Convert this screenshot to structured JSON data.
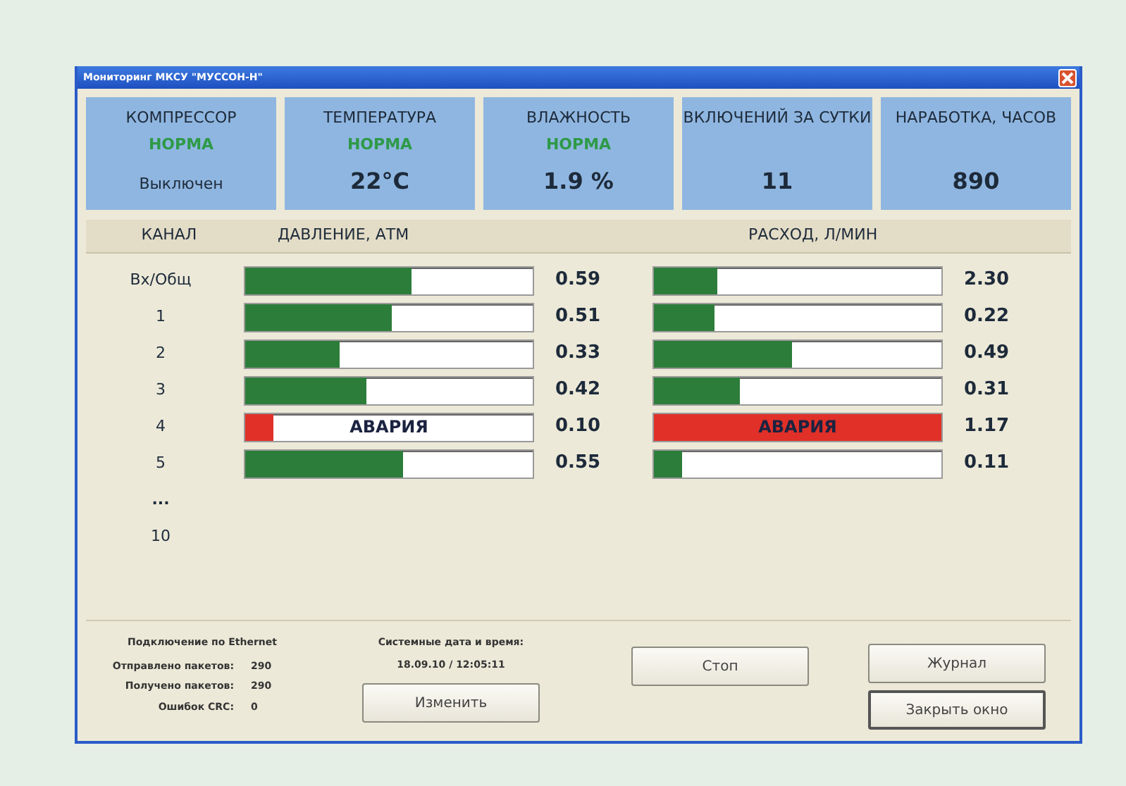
{
  "window": {
    "title": "Мониторинг МКСУ \"МУССОН-Н\""
  },
  "tiles": [
    {
      "label": "КОМПРЕССОР",
      "status": "НОРМА",
      "value": "Выключен",
      "kind": "small"
    },
    {
      "label": "ТЕМПЕРАТУРА",
      "status": "НОРМА",
      "value": "22°C",
      "kind": "big"
    },
    {
      "label": "ВЛАЖНОСТЬ",
      "status": "НОРМА",
      "value": "1.9 %",
      "kind": "big"
    },
    {
      "label": "ВКЛЮЧЕНИЙ ЗА СУТКИ",
      "value": "11",
      "kind": "big"
    },
    {
      "label": "НАРАБОТКА, ЧАСОВ",
      "value": "890",
      "kind": "big"
    }
  ],
  "table": {
    "columns": [
      "КАНАЛ",
      "ДАВЛЕНИЕ, АТМ",
      "РАСХОД, Л/МИН"
    ],
    "rows": [
      {
        "kind": "bars",
        "channel": "Вх/Общ",
        "pressure": {
          "level": 0.58,
          "alarm": false,
          "reading": "0.59"
        },
        "flow": {
          "level": 0.22,
          "alarm": false,
          "reading": "2.30"
        }
      },
      {
        "kind": "bars",
        "channel": "1",
        "pressure": {
          "level": 0.51,
          "alarm": false,
          "reading": "0.51"
        },
        "flow": {
          "level": 0.21,
          "alarm": false,
          "reading": "0.22"
        }
      },
      {
        "kind": "bars",
        "channel": "2",
        "pressure": {
          "level": 0.33,
          "alarm": false,
          "reading": "0.33"
        },
        "flow": {
          "level": 0.48,
          "alarm": false,
          "reading": "0.49"
        }
      },
      {
        "kind": "bars",
        "channel": "3",
        "pressure": {
          "level": 0.42,
          "alarm": false,
          "reading": "0.42"
        },
        "flow": {
          "level": 0.3,
          "alarm": false,
          "reading": "0.31"
        }
      },
      {
        "kind": "bars",
        "channel": "4",
        "pressure": {
          "level": 0.1,
          "alarm": true,
          "alarm_text": "АВАРИЯ",
          "reading": "0.10"
        },
        "flow": {
          "level": 1,
          "alarm": true,
          "alarm_text": "АВАРИЯ",
          "reading": "1.17"
        }
      },
      {
        "kind": "bars",
        "channel": "5",
        "pressure": {
          "level": 0.55,
          "alarm": false,
          "reading": "0.55"
        },
        "flow": {
          "level": 0.1,
          "alarm": false,
          "reading": "0.11"
        }
      },
      {
        "kind": "label",
        "channel": "..."
      },
      {
        "kind": "label",
        "channel": "10"
      }
    ]
  },
  "ethernet": {
    "title": "Подключение по Ethernet",
    "stats": [
      {
        "label": "Отправлено пакетов:",
        "value": "290"
      },
      {
        "label": "Получено пакетов:",
        "value": "290"
      },
      {
        "label": "Ошибок CRC:",
        "value": "0"
      }
    ]
  },
  "system_time": {
    "title": "Системные дата и время:",
    "value": "18.09.10 / 12:05:11",
    "button": "Изменить"
  },
  "buttons": [
    {
      "label": "Стоп",
      "default": false
    },
    {
      "label": "Журнал",
      "default": false
    },
    {
      "label": "Закрыть окно",
      "default": true
    }
  ]
}
